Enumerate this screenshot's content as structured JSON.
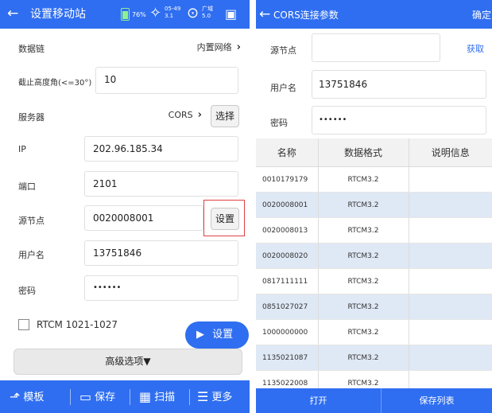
{
  "left": {
    "header": {
      "back_icon": "←",
      "title": "设置移动站",
      "battery_pct": "76%",
      "sat_line1": "05-49",
      "sat_line2": "3.1",
      "fix_line1": "广域",
      "fix_line2": "5.0"
    },
    "rows": {
      "datalink_label": "数据链",
      "datalink_value": "内置网络",
      "elev_label": "截止高度角(<=30°)",
      "elev_value": "10",
      "server_label": "服务器",
      "server_value": "CORS",
      "server_select": "选择",
      "ip_label": "IP",
      "ip_value": "202.96.185.34",
      "port_label": "端口",
      "port_value": "2101",
      "mount_label": "源节点",
      "mount_value": "0020008001",
      "mount_set": "设置",
      "user_label": "用户名",
      "user_value": "13751846",
      "pwd_label": "密码",
      "pwd_value": "••••••",
      "rtcm_label": "RTCM 1021-1027"
    },
    "set_button": "设置",
    "advanced": "高级选项▼",
    "bottom": {
      "template": "模板",
      "save": "保存",
      "scan": "扫描",
      "more": "更多"
    }
  },
  "right": {
    "header": {
      "back_icon": "←",
      "title": "CORS连接参数",
      "confirm": "确定"
    },
    "mount_label": "源节点",
    "mount_value": "",
    "fetch": "获取",
    "user_label": "用户名",
    "user_value": "13751846",
    "pwd_label": "密码",
    "pwd_value": "••••••",
    "table": {
      "headers": [
        "名称",
        "数据格式",
        "说明信息"
      ],
      "rows": [
        [
          "0010179179",
          "RTCM3.2",
          ""
        ],
        [
          "0020008001",
          "RTCM3.2",
          ""
        ],
        [
          "0020008013",
          "RTCM3.2",
          ""
        ],
        [
          "0020008020",
          "RTCM3.2",
          ""
        ],
        [
          "0817111111",
          "RTCM3.2",
          ""
        ],
        [
          "0851027027",
          "RTCM3.2",
          ""
        ],
        [
          "1000000000",
          "RTCM3.2",
          ""
        ],
        [
          "1135021087",
          "RTCM3.2",
          ""
        ],
        [
          "1135022008",
          "RTCM3.2",
          ""
        ]
      ]
    },
    "bottom": {
      "open": "打开",
      "save_list": "保存列表"
    }
  },
  "colors": {
    "accent": "#2f6ef0",
    "alt_row": "#dfe8f5",
    "highlight": "#e04040"
  }
}
